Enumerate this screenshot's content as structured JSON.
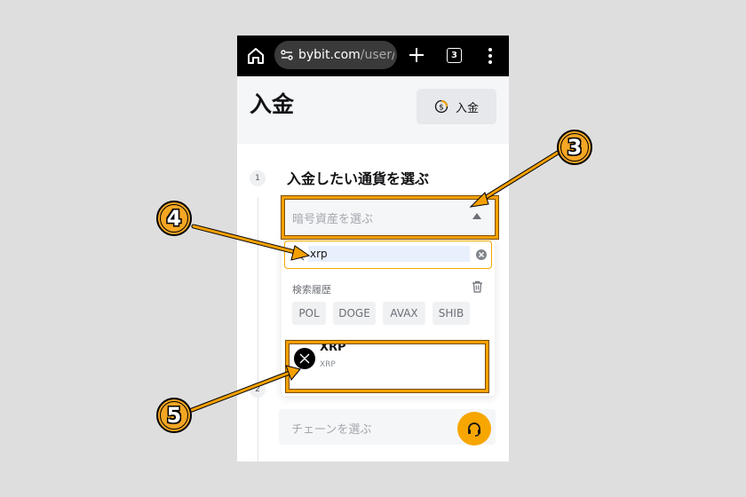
{
  "browser": {
    "url_host": "bybit.com",
    "url_path": "/user/a",
    "tab_count": "3"
  },
  "header": {
    "title": "入金",
    "deposit_button_label": "入金"
  },
  "step1": {
    "number": "1",
    "title": "入金したい通貨を選ぶ",
    "coin_select_placeholder": "暗号資産を選ぶ"
  },
  "dropdown": {
    "search_value": "xrp",
    "history_label": "検索履歴",
    "history_chips": [
      "POL",
      "DOGE",
      "AVAX",
      "SHIB"
    ],
    "result": {
      "symbol": "XRP",
      "name": "XRP"
    }
  },
  "step2": {
    "number": "2",
    "chain_placeholder": "チェーンを選ぶ"
  },
  "annotations": {
    "callouts": [
      "3",
      "4",
      "5"
    ],
    "highlight_color": "#f5a000"
  },
  "colors": {
    "accent": "#f7a600",
    "browser_bar": "#000000"
  }
}
